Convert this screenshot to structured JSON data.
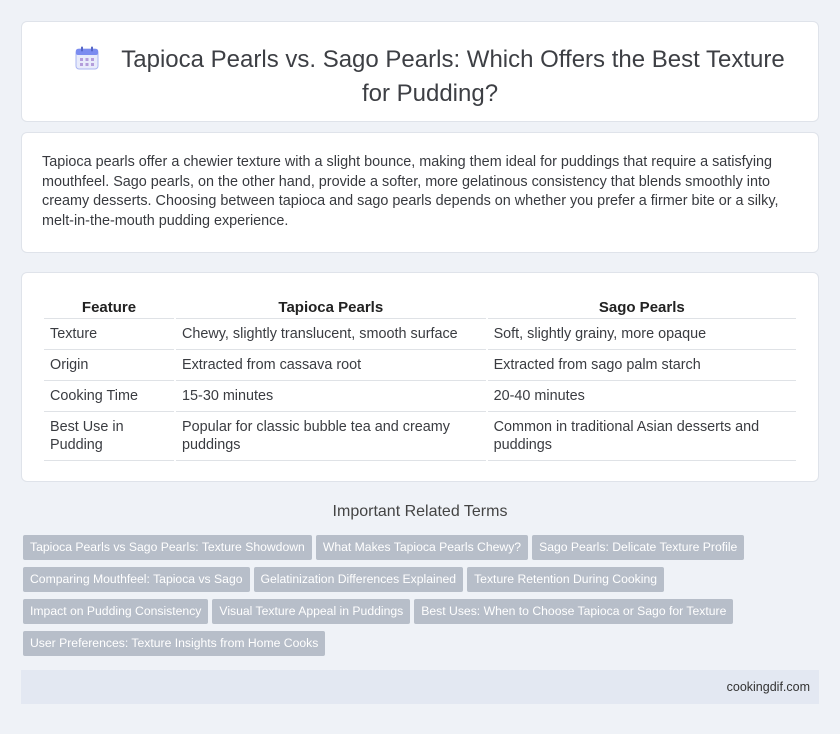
{
  "header": {
    "title": "Tapioca Pearls vs. Sago Pearls: Which Offers the Best Texture for Pudding?",
    "icon": "calendar-icon"
  },
  "intro": {
    "text": "Tapioca pearls offer a chewier texture with a slight bounce, making them ideal for puddings that require a satisfying mouthfeel. Sago pearls, on the other hand, provide a softer, more gelatinous consistency that blends smoothly into creamy desserts. Choosing between tapioca and sago pearls depends on whether you prefer a firmer bite or a silky, melt-in-the-mouth pudding experience."
  },
  "table": {
    "headers": [
      "Feature",
      "Tapioca Pearls",
      "Sago Pearls"
    ],
    "rows": [
      [
        "Texture",
        "Chewy, slightly translucent, smooth surface",
        "Soft, slightly grainy, more opaque"
      ],
      [
        "Origin",
        "Extracted from cassava root",
        "Extracted from sago palm starch"
      ],
      [
        "Cooking Time",
        "15-30 minutes",
        "20-40 minutes"
      ],
      [
        "Best Use in Pudding",
        "Popular for classic bubble tea and creamy puddings",
        "Common in traditional Asian desserts and puddings"
      ]
    ]
  },
  "related": {
    "title": "Important Related Terms",
    "tags": [
      "Tapioca Pearls vs Sago Pearls: Texture Showdown",
      "What Makes Tapioca Pearls Chewy?",
      "Sago Pearls: Delicate Texture Profile",
      "Comparing Mouthfeel: Tapioca vs Sago",
      "Gelatinization Differences Explained",
      "Texture Retention During Cooking",
      "Impact on Pudding Consistency",
      "Visual Texture Appeal in Puddings",
      "Best Uses: When to Choose Tapioca or Sago for Texture",
      "User Preferences: Texture Insights from Home Cooks"
    ]
  },
  "footer": {
    "site": "cookingdif.com"
  },
  "colors": {
    "tag_bg": "#b7bec9",
    "page_bg": "#eff2f7",
    "footer_bg": "#e3e8f2",
    "icon_accent": "#7b8cf0"
  }
}
